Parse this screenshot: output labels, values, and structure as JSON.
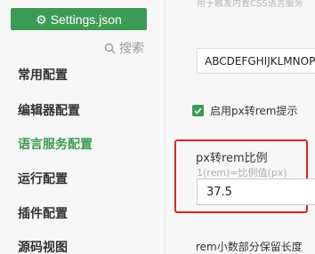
{
  "header": {
    "settings_button_label": "Settings.json"
  },
  "sidebar": {
    "search_label": "搜索",
    "items": [
      {
        "label": "常用配置",
        "active": false
      },
      {
        "label": "编辑器配置",
        "active": false
      },
      {
        "label": "语言服务配置",
        "active": true
      },
      {
        "label": "运行配置",
        "active": false
      },
      {
        "label": "插件配置",
        "active": false
      },
      {
        "label": "源码视图",
        "active": false
      }
    ]
  },
  "main": {
    "truncated_hint": "用于触发内置CSS语言服务",
    "font_input_value": "ABCDEFGHIJKLMNOPQRSTUVWXYZ",
    "px_to_rem_checkbox": {
      "label": "启用px转rem提示",
      "checked": true
    },
    "px_to_rem_ratio": {
      "title": "px转rem比例",
      "hint": "1(rem)=比例值(px)",
      "value": "37.5"
    },
    "rem_decimal_label": "rem小数部分保留长度"
  },
  "colors": {
    "accent_green": "#3c9b54",
    "highlight_red": "#e0241d"
  }
}
